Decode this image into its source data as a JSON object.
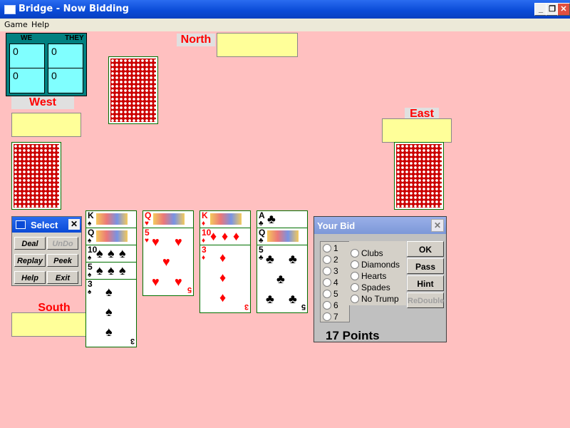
{
  "window": {
    "title": "Bridge - Now Bidding",
    "minimize": "_",
    "maximize": "❐",
    "close": "✕"
  },
  "menu": [
    "Game",
    "Help"
  ],
  "score": {
    "headers": [
      "WE",
      "THEY"
    ],
    "rows": [
      [
        "0",
        "0"
      ],
      [
        "0",
        "0"
      ]
    ]
  },
  "seats": {
    "north": "North",
    "west": "West",
    "east": "East",
    "south": "South"
  },
  "select_panel": {
    "title": "Select",
    "close": "✕",
    "buttons": [
      "Deal",
      "UnDo",
      "Replay",
      "Peek",
      "Help",
      "Exit"
    ],
    "disabled": [
      "UnDo"
    ]
  },
  "south_hand": [
    {
      "suit": "spades",
      "symbol": "♠",
      "color": "#000000",
      "ranks": [
        "K",
        "Q",
        "10",
        "5",
        "3"
      ]
    },
    {
      "suit": "hearts",
      "symbol": "♥",
      "color": "#ff0000",
      "ranks": [
        "Q",
        "5"
      ]
    },
    {
      "suit": "diamonds",
      "symbol": "♦",
      "color": "#ff0000",
      "ranks": [
        "K",
        "10",
        "3"
      ]
    },
    {
      "suit": "clubs",
      "symbol": "♣",
      "color": "#000000",
      "ranks": [
        "A",
        "Q",
        "5"
      ]
    }
  ],
  "your_bid": {
    "title": "Your Bid",
    "close": "✕",
    "levels": [
      "1",
      "2",
      "3",
      "4",
      "5",
      "6",
      "7"
    ],
    "strains": [
      "Clubs",
      "Diamonds",
      "Hearts",
      "Spades",
      "No Trump"
    ],
    "buttons": [
      "OK",
      "Pass",
      "Hint",
      "ReDouble"
    ],
    "disabled": [
      "ReDouble"
    ],
    "points": "17 Points"
  },
  "colors": {
    "felt": "#ffc0c0",
    "seat_label": "#ff0000",
    "bid_box": "#ffff99",
    "card_back": "#cc0000",
    "score_cell": "#80ffff"
  }
}
